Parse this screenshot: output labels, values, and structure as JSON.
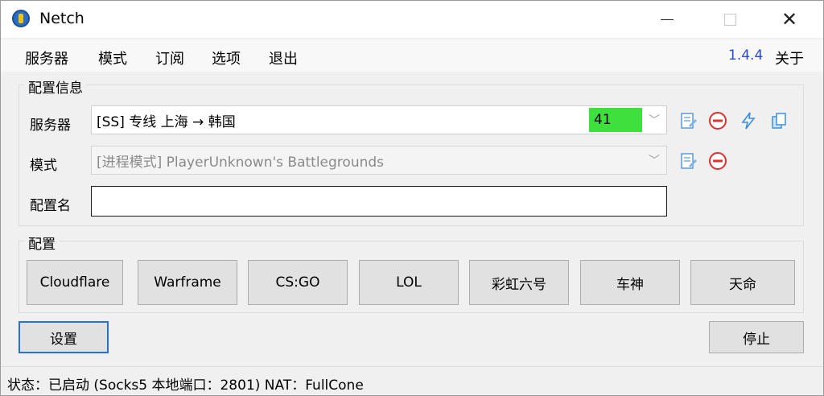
{
  "window": {
    "title": "Netch"
  },
  "menu": {
    "items": [
      "服务器",
      "模式",
      "订阅",
      "选项",
      "退出"
    ],
    "version": "1.4.4",
    "about": "关于"
  },
  "config_info": {
    "group_title": "配置信息",
    "server_label": "服务器",
    "server_value": "[SS] 专线 上海 → 韩国",
    "server_latency": "41",
    "mode_label": "模式",
    "mode_value": "[进程模式] PlayerUnknown's Battlegrounds",
    "profile_name_label": "配置名",
    "profile_name_value": ""
  },
  "profiles": {
    "group_title": "配置",
    "buttons": [
      "Cloudflare",
      "Warframe",
      "CS:GO",
      "LOL",
      "彩虹六号",
      "车神",
      "天命"
    ]
  },
  "actions": {
    "settings": "设置",
    "stop": "停止"
  },
  "status": {
    "text": "状态：已启动 (Socks5 本地端口：2801)  NAT：FullCone"
  },
  "colors": {
    "latency_bg": "#3ee03e",
    "version_text": "#2b4bcf",
    "focus_border": "#2670d7",
    "icon_blue": "#3a8fe0",
    "icon_red": "#e03030"
  },
  "icons": {
    "edit": "edit-icon",
    "remove": "remove-icon",
    "speedtest": "lightning-icon",
    "copy": "copy-icon"
  }
}
